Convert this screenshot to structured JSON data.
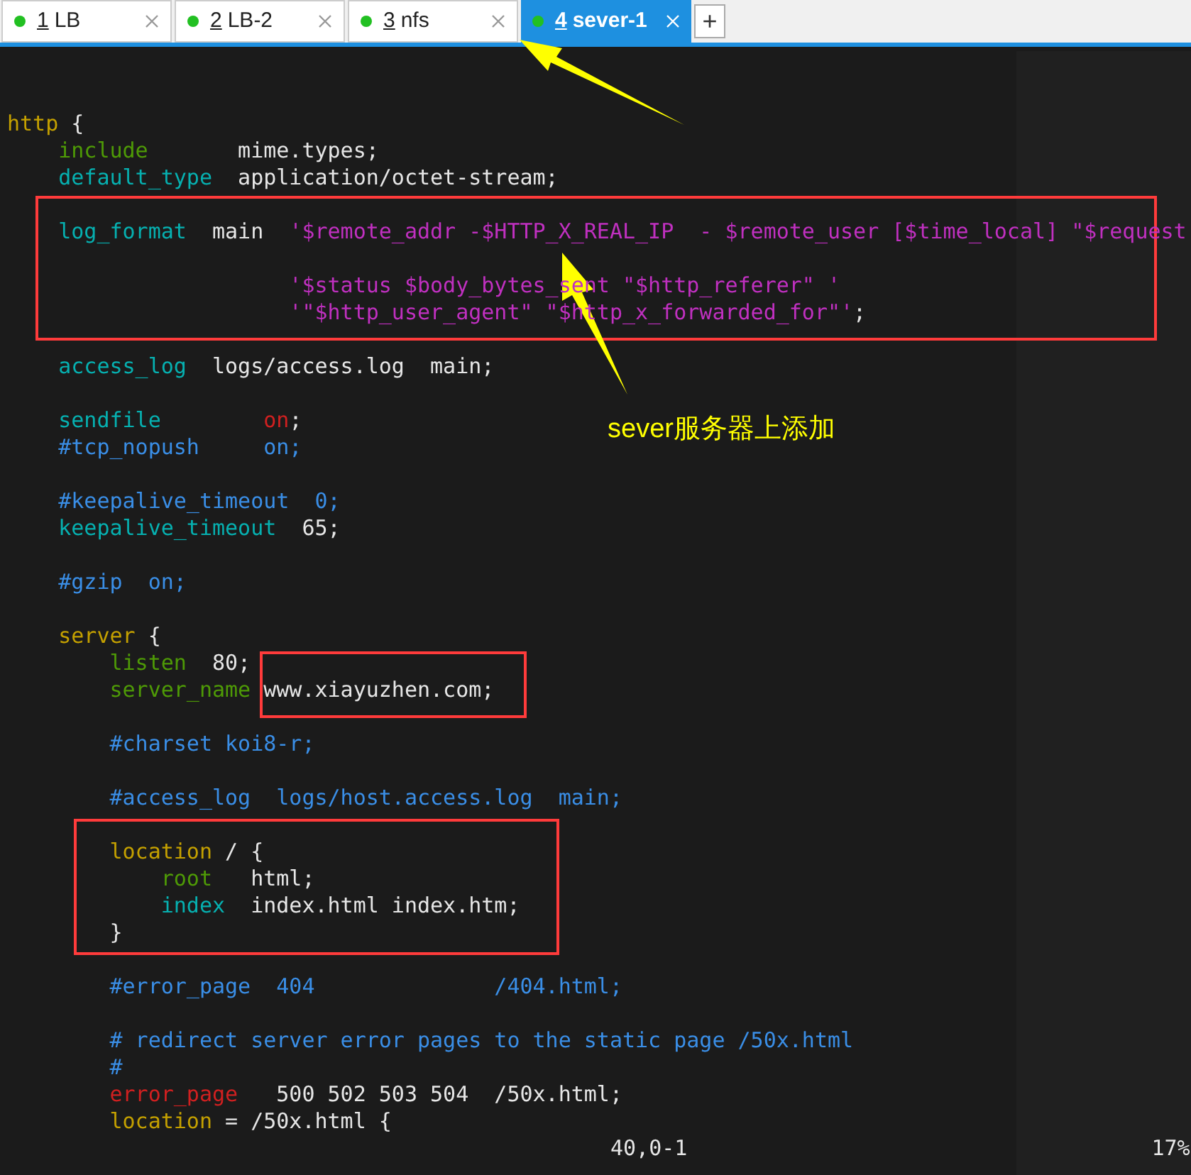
{
  "tabs": [
    {
      "number": "1",
      "label": "LB",
      "selected": false
    },
    {
      "number": "2",
      "label": "LB-2",
      "selected": false
    },
    {
      "number": "3",
      "label": "nfs",
      "selected": false
    },
    {
      "number": "4",
      "label": "sever-1",
      "selected": true
    }
  ],
  "add_tab": "+",
  "editor": {
    "lines": [
      {
        "kind": "code",
        "segments": [
          {
            "text": "http",
            "kind": "keyword"
          },
          {
            "text": " {",
            "kind": "plain"
          }
        ]
      },
      {
        "kind": "code",
        "segments": [
          {
            "text": "    include",
            "kind": "directive"
          },
          {
            "text": "       mime.types;",
            "kind": "plain"
          }
        ]
      },
      {
        "kind": "code",
        "segments": [
          {
            "text": "    default_type",
            "kind": "builtin"
          },
          {
            "text": "  application/octet-stream;",
            "kind": "plain"
          }
        ]
      },
      {
        "kind": "blank"
      },
      {
        "kind": "code",
        "segments": [
          {
            "text": "    log_format",
            "kind": "builtin"
          },
          {
            "text": "  main  ",
            "kind": "plain"
          },
          {
            "text": "'$remote_addr -$HTTP_X_REAL_IP  - $remote_user [$time_local] \"$request",
            "kind": "string"
          }
        ]
      },
      {
        "kind": "blank"
      },
      {
        "kind": "code",
        "segments": [
          {
            "text": "                      '$status $body_bytes_sent \"$http_referer\" '",
            "kind": "string"
          }
        ]
      },
      {
        "kind": "code",
        "segments": [
          {
            "text": "                      '\"$http_user_agent\" \"$http_x_forwarded_for\"'",
            "kind": "string"
          },
          {
            "text": ";",
            "kind": "plain"
          }
        ]
      },
      {
        "kind": "blank"
      },
      {
        "kind": "code",
        "segments": [
          {
            "text": "    access_log",
            "kind": "builtin"
          },
          {
            "text": "  logs/access.log  main;",
            "kind": "plain"
          }
        ]
      },
      {
        "kind": "blank"
      },
      {
        "kind": "code",
        "segments": [
          {
            "text": "    sendfile",
            "kind": "builtin"
          },
          {
            "text": "        on",
            "kind": "value"
          },
          {
            "text": ";",
            "kind": "plain"
          }
        ]
      },
      {
        "kind": "code",
        "segments": [
          {
            "text": "    #tcp_nopush     on;",
            "kind": "comment"
          }
        ]
      },
      {
        "kind": "blank"
      },
      {
        "kind": "code",
        "segments": [
          {
            "text": "    #keepalive_timeout  0;",
            "kind": "comment"
          }
        ]
      },
      {
        "kind": "code",
        "segments": [
          {
            "text": "    keepalive_timeout",
            "kind": "builtin"
          },
          {
            "text": "  65;",
            "kind": "plain"
          }
        ]
      },
      {
        "kind": "blank"
      },
      {
        "kind": "code",
        "segments": [
          {
            "text": "    #gzip  on;",
            "kind": "comment"
          }
        ]
      },
      {
        "kind": "blank"
      },
      {
        "kind": "code",
        "segments": [
          {
            "text": "    server",
            "kind": "keyword"
          },
          {
            "text": " {",
            "kind": "plain"
          }
        ]
      },
      {
        "kind": "code",
        "segments": [
          {
            "text": "        listen",
            "kind": "directive"
          },
          {
            "text": "  80;",
            "kind": "plain"
          }
        ]
      },
      {
        "kind": "code",
        "segments": [
          {
            "text": "        server_name",
            "kind": "directive"
          },
          {
            "text": " www.xiayuzhen.com;",
            "kind": "plain"
          }
        ]
      },
      {
        "kind": "blank"
      },
      {
        "kind": "code",
        "segments": [
          {
            "text": "        #charset koi8-r;",
            "kind": "comment"
          }
        ]
      },
      {
        "kind": "blank"
      },
      {
        "kind": "code",
        "segments": [
          {
            "text": "        #access_log  logs/host.access.log  main;",
            "kind": "comment"
          }
        ]
      },
      {
        "kind": "blank"
      },
      {
        "kind": "code",
        "segments": [
          {
            "text": "        location",
            "kind": "keyword"
          },
          {
            "text": " / {",
            "kind": "plain"
          }
        ]
      },
      {
        "kind": "code",
        "segments": [
          {
            "text": "            root",
            "kind": "directive"
          },
          {
            "text": "   html;",
            "kind": "plain"
          }
        ]
      },
      {
        "kind": "code",
        "segments": [
          {
            "text": "            index",
            "kind": "builtin"
          },
          {
            "text": "  index.html index.htm;",
            "kind": "plain"
          }
        ]
      },
      {
        "kind": "code",
        "segments": [
          {
            "text": "        }",
            "kind": "plain"
          }
        ]
      },
      {
        "kind": "blank"
      },
      {
        "kind": "code",
        "segments": [
          {
            "text": "        #error_page  404              /404.html;",
            "kind": "comment"
          }
        ]
      },
      {
        "kind": "blank"
      },
      {
        "kind": "code",
        "segments": [
          {
            "text": "        # redirect server error pages to the static page /50x.html",
            "kind": "comment"
          }
        ]
      },
      {
        "kind": "code",
        "segments": [
          {
            "text": "        #",
            "kind": "comment"
          }
        ]
      },
      {
        "kind": "code",
        "segments": [
          {
            "text": "        error_page",
            "kind": "value"
          },
          {
            "text": "   500 502 503 504  /50x.html;",
            "kind": "plain"
          }
        ]
      },
      {
        "kind": "code",
        "segments": [
          {
            "text": "        location",
            "kind": "keyword"
          },
          {
            "text": " = /50x.html {",
            "kind": "plain"
          }
        ]
      }
    ]
  },
  "status_line": {
    "position": "40,0-1",
    "percent": "17%"
  },
  "annotation": "sever服务器上添加"
}
